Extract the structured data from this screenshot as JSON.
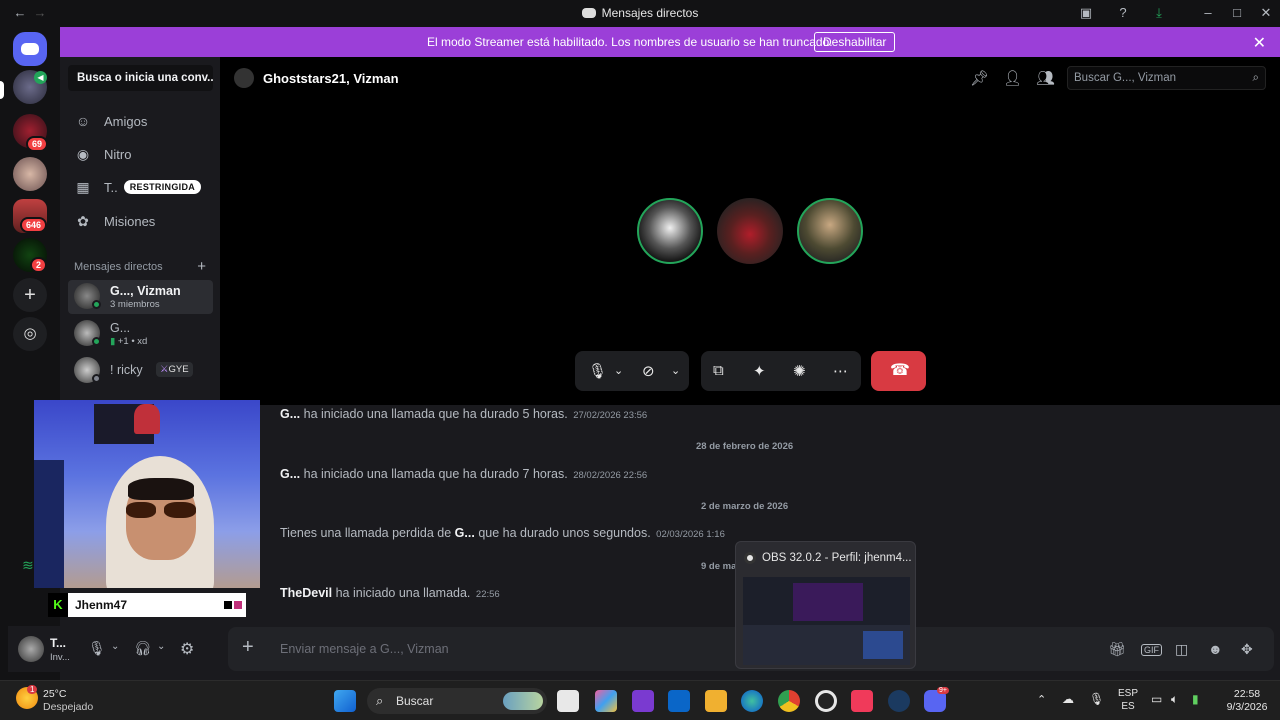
{
  "window": {
    "title": "Mensajes directos"
  },
  "banner": {
    "message": "El modo Streamer está habilitado. Los nombres de usuario se han truncado.",
    "button": "Deshabilitar"
  },
  "rail": {
    "badges": [
      "69",
      "646",
      "2"
    ]
  },
  "sidebar": {
    "search_label": "Busca o inicia una conv...",
    "nav": [
      {
        "label": "Amigos",
        "icon": "friends-icon"
      },
      {
        "label": "Nitro",
        "icon": "nitro-icon"
      },
      {
        "label": "T..",
        "icon": "shop-icon",
        "tag": "RESTRINGIDA"
      },
      {
        "label": "Misiones",
        "icon": "quests-icon"
      }
    ],
    "dm_header": "Mensajes directos",
    "dms": [
      {
        "name": "G..., Vizman",
        "sub": "3 miembros"
      },
      {
        "name": "G...",
        "sub": "+1 • xd"
      },
      {
        "name": "! ricky",
        "tag": "GYE"
      }
    ]
  },
  "call": {
    "channel_name": "Ghoststars21, Vizman",
    "search_placeholder": "Buscar G..., Vizman"
  },
  "chat": {
    "messages": [
      {
        "name": "G...",
        "text": "ha iniciado una llamada que ha durado 5 horas.",
        "time": "27/02/2026 23:56"
      },
      {
        "name": "G...",
        "text": "ha iniciado una llamada que ha durado 7 horas.",
        "time": "28/02/2026 22:56"
      },
      {
        "pre": "Tienes una llamada perdida de",
        "name": "G...",
        "text": "que ha durado unos segundos.",
        "time": "02/03/2026 1:16"
      },
      {
        "name": "TheDevil",
        "text": "ha iniciado una llamada.",
        "time": "22:56"
      }
    ],
    "dividers": [
      "28 de febrero de 2026",
      "2 de marzo de 2026",
      "9 de ma"
    ],
    "composer_placeholder": "Enviar mensaje a G..., Vizman"
  },
  "user": {
    "name": "T...",
    "status": "Inv..."
  },
  "webcam": {
    "name": "Jhenm47"
  },
  "obs": {
    "title": "OBS 32.0.2 - Perfil: jhenm4..."
  },
  "taskbar": {
    "weather_temp": "25°C",
    "weather_desc": "Despejado",
    "search": "Buscar",
    "lang1": "ESP",
    "lang2": "ES",
    "time": "22:58",
    "date": "9/3/2026",
    "notif_badge": "1",
    "discord_badge": "9+"
  },
  "colors": {
    "accent": "#9b3fd8",
    "hangup": "#d83a42",
    "online": "#23a55a",
    "badge": "#f23f42"
  }
}
